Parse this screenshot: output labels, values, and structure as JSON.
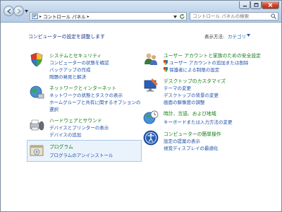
{
  "window": {
    "breadcrumb": [
      "コントロール パネル"
    ],
    "search_placeholder": "コントロール パネルの検索"
  },
  "content": {
    "heading": "コンピューターの設定を調整します",
    "view_by_label": "表示方法:",
    "view_by_value": "カテゴリ"
  },
  "categories_left": [
    {
      "title": "システムとセキュリティ",
      "icon": "system-security-icon",
      "links": [
        "コンピューターの状態を確認",
        "バックアップの作成",
        "問題の発見と解決"
      ]
    },
    {
      "title": "ネットワークとインターネット",
      "icon": "network-internet-icon",
      "links": [
        "ネットワークの状態とタスクの表示",
        "ホームグループと共有に関するオプションの",
        "選択"
      ]
    },
    {
      "title": "ハードウェアとサウンド",
      "icon": "hardware-sound-icon",
      "links": [
        "デバイスとプリンターの表示",
        "デバイスの追加"
      ]
    },
    {
      "title": "プログラム",
      "icon": "programs-icon",
      "links": [
        "プログラムのアンインストール"
      ]
    }
  ],
  "categories_right": [
    {
      "title": "ユーザー アカウントと家族のための安全設定",
      "icon": "user-accounts-icon",
      "links": [
        "ユーザー アカウントの追加または削除",
        "保護者による制限の設定"
      ]
    },
    {
      "title": "デスクトップのカスタマイズ",
      "icon": "appearance-icon",
      "links": [
        "テーマの変更",
        "デスクトップの背景の変更",
        "画面の解像度の調整"
      ]
    },
    {
      "title": "時計、言語、および地域",
      "icon": "clock-language-region-icon",
      "links": [
        "キーボードまたは入力方法の変更"
      ]
    },
    {
      "title": "コンピューターの簡単操作",
      "icon": "ease-of-access-icon",
      "links": [
        "設定の提案の表示",
        "視覚ディスプレイの最適化"
      ]
    }
  ],
  "colors": {
    "category_title": "#137b13",
    "link": "#1e50a8",
    "heading": "#1e3287"
  }
}
